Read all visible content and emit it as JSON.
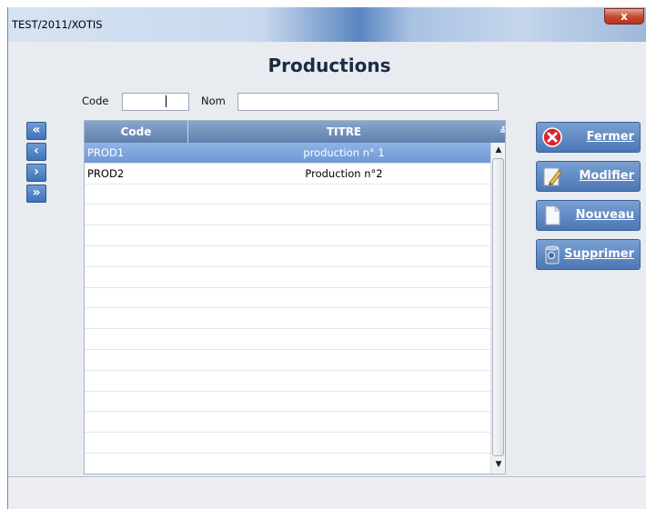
{
  "window": {
    "title": "TEST/2011/XOTIS",
    "close_label": "x"
  },
  "heading": "Productions",
  "filters": {
    "code_label": "Code",
    "code_value": "",
    "nom_label": "Nom",
    "nom_value": ""
  },
  "nav": {
    "first": "«",
    "prev": "‹",
    "next": "›",
    "last": "»"
  },
  "grid": {
    "columns": [
      "Code",
      "TITRE"
    ],
    "column_selector": "≚",
    "rows": [
      {
        "code": "PROD1",
        "titre": "production n° 1",
        "selected": true
      },
      {
        "code": "PROD2",
        "titre": "Production n°2",
        "selected": false
      }
    ],
    "scroll_up": "▲",
    "scroll_down": "▼"
  },
  "actions": {
    "fermer": "Fermer",
    "modifier": "Modifier",
    "nouveau": "Nouveau",
    "supprimer": "Supprimer"
  },
  "colors": {
    "accent": "#4c77b5",
    "selection": "#7fa6dd",
    "header": "#6f8fbd"
  }
}
